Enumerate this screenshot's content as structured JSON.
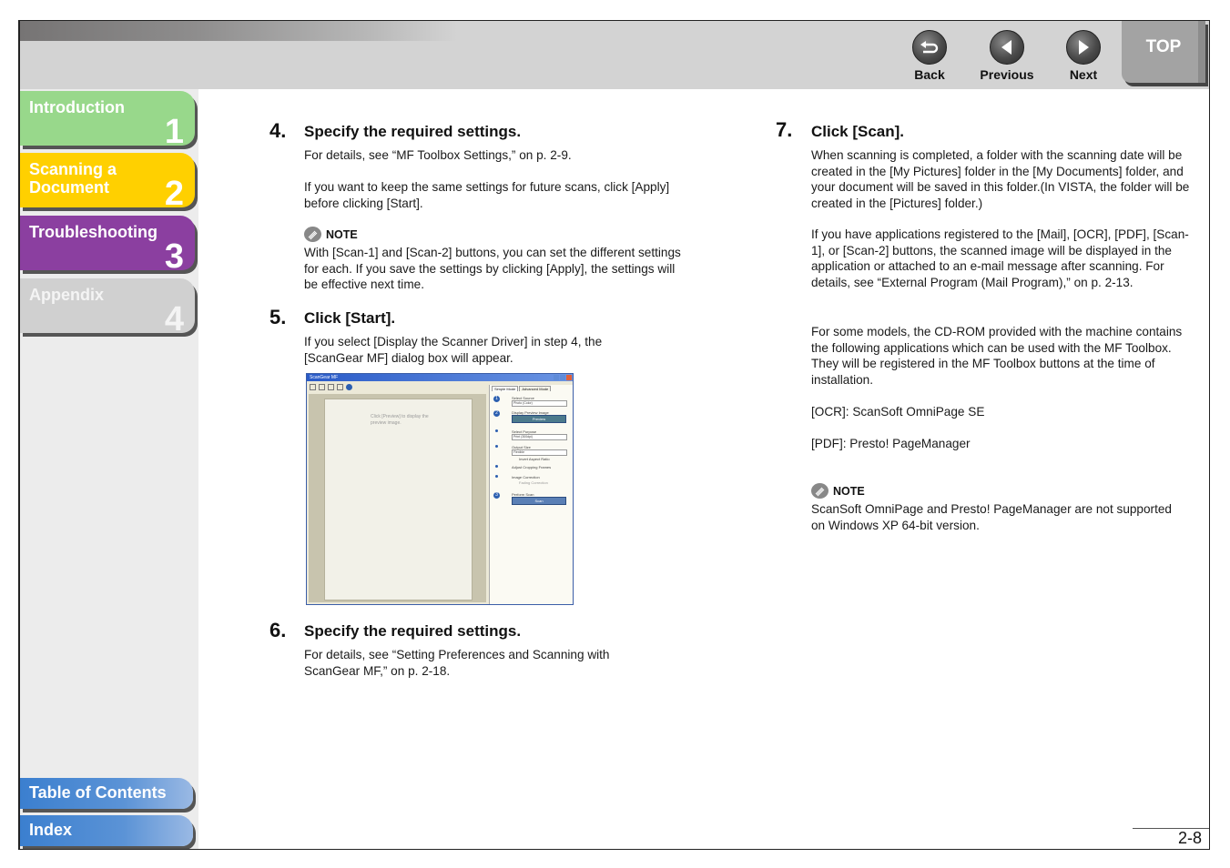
{
  "nav": {
    "back": {
      "label": "Back",
      "icon": "back-arrow-icon"
    },
    "previous": {
      "label": "Previous",
      "icon": "left-triangle-icon"
    },
    "next": {
      "label": "Next",
      "icon": "right-triangle-icon"
    },
    "top": {
      "label": "TOP"
    }
  },
  "sidebar": {
    "chapters": [
      {
        "title": "Introduction",
        "number": "1",
        "color": "#98d88b"
      },
      {
        "title": "Scanning a Document",
        "title_line1": "Scanning a",
        "title_line2": "Document",
        "number": "2",
        "color": "#ffd000"
      },
      {
        "title": "Troubleshooting",
        "number": "3",
        "color": "#8b3fa0"
      },
      {
        "title": "Appendix",
        "number": "4",
        "color": "#d0d0d0"
      }
    ],
    "toc": "Table of Contents",
    "index": "Index"
  },
  "content": {
    "steps": [
      {
        "number": "4.",
        "title": "Specify the required settings.",
        "paragraphs": [
          "For details, see “MF Toolbox Settings,” on p. 2-9.",
          "If you want to keep the same settings for future scans, click [Apply] before clicking [Start]."
        ],
        "note": {
          "label": "NOTE",
          "text": "With [Scan-1] and [Scan-2] buttons, you can set the different settings for each. If you save the settings by clicking [Apply], the settings will be effective next time."
        }
      },
      {
        "number": "5.",
        "title": "Click [Start].",
        "paragraphs": [
          "If you select [Display the Scanner Driver] in step 4, the [ScanGear MF] dialog box will appear."
        ]
      },
      {
        "number": "6.",
        "title": "Specify the required settings.",
        "paragraphs": [
          "For details, see “Setting Preferences and Scanning with ScanGear MF,” on p. 2-18."
        ]
      },
      {
        "number": "7.",
        "title": "Click [Scan].",
        "paragraphs": [
          "When scanning is completed, a folder with the scanning date will be created in the [My Pictures] folder in the [My Documents] folder, and your document will be saved in this folder.(In VISTA, the folder will be created in the [Pictures] folder.)",
          "If you have applications registered to the [Mail], [OCR], [PDF], [Scan-1], or [Scan-2] buttons, the scanned image will be displayed in the application or attached to an e-mail message after scanning. For details, see “External Program (Mail Program),” on p. 2-13.",
          "For some models, the CD-ROM provided with the machine contains the following applications which can be used with the MF Toolbox. They will be registered in the MF Toolbox buttons at the time of installation.",
          "[OCR]: ScanSoft OmniPage SE",
          "[PDF]: Presto! PageManager"
        ],
        "note": {
          "label": "NOTE",
          "text": "ScanSoft OmniPage and Presto! PageManager are not supported on Windows XP 64-bit version."
        }
      }
    ],
    "screenshot": {
      "window_title": "ScanGear MF",
      "tabs": [
        "Simple Mode",
        "Advanced Mode"
      ],
      "preview_hint": "Click [Preview] to display the preview image.",
      "sections": [
        {
          "step": "1",
          "label": "Select Source",
          "value": "Photo (Color)"
        },
        {
          "step": "2",
          "label": "Display Preview Image",
          "button": "Preview"
        },
        {
          "label": "Select Purpose",
          "value": "Print (300dpi)"
        },
        {
          "label": "Output Size",
          "value": "Flexible",
          "checkbox": "Invert Aspect Ratio"
        },
        {
          "checkbox": "Adjust Cropping Frames"
        },
        {
          "label": "Image Correction",
          "checkbox": "Fading Correction"
        },
        {
          "step": "3",
          "label": "Perform Scan",
          "button": "Scan"
        }
      ]
    }
  },
  "footer": {
    "page_number": "2-8"
  }
}
